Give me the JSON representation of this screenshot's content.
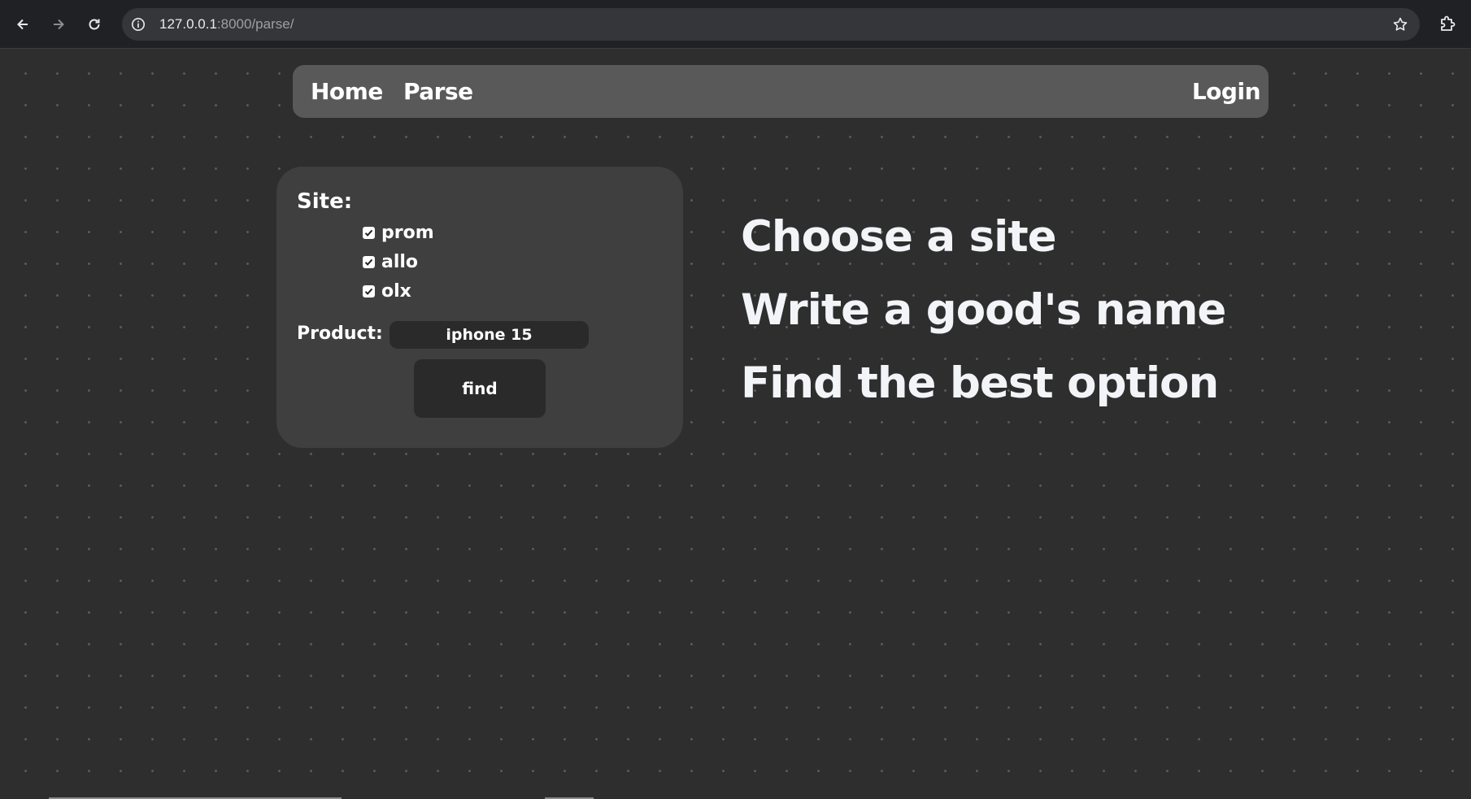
{
  "browser": {
    "url_host": "127.0.0.1",
    "url_rest": ":8000/parse/"
  },
  "nav": {
    "home": "Home",
    "parse": "Parse",
    "login": "Login"
  },
  "form": {
    "site_label": "Site:",
    "sites": [
      {
        "label": "prom",
        "checked": true
      },
      {
        "label": "allo",
        "checked": true
      },
      {
        "label": "olx",
        "checked": true
      }
    ],
    "product_label": "Product:",
    "product_value": "iphone 15",
    "find_label": "find"
  },
  "taglines": [
    "Choose a site",
    "Write a good's name",
    "Find the best option"
  ],
  "colors": {
    "page_bg": "#2e2e2e",
    "nav_bg": "#595959",
    "card_bg": "#3f3f3f",
    "input_bg": "#2a2a2a"
  }
}
